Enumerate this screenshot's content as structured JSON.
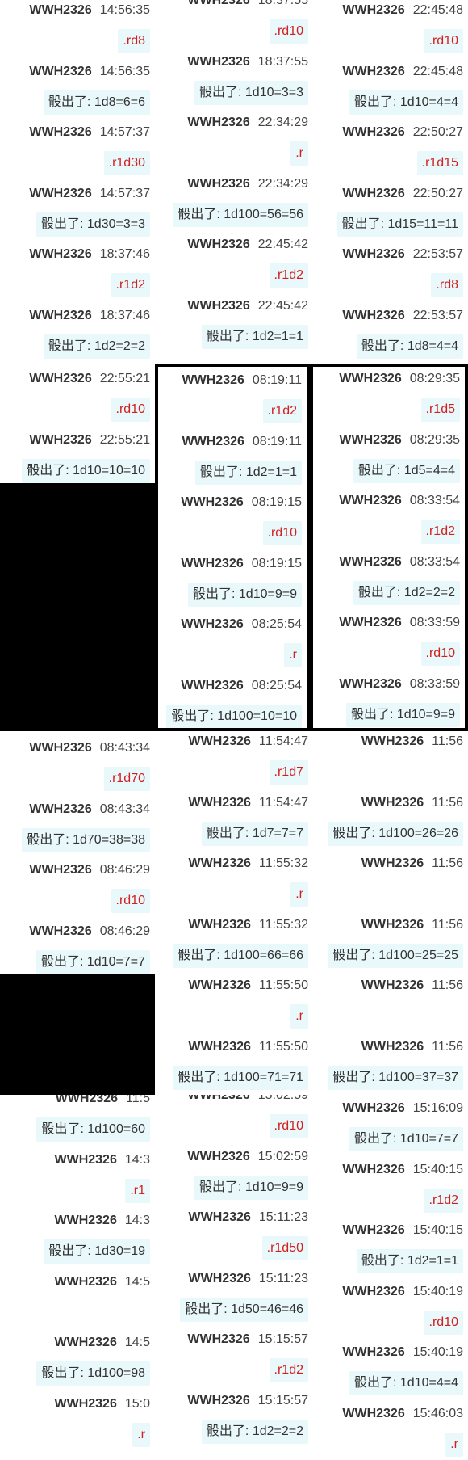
{
  "tiles": [
    {
      "messages": [
        {
          "name": "WWH2326",
          "time": "14:56:35",
          "type": "cmd",
          "text": ".rd8"
        },
        {
          "name": "WWH2326",
          "time": "14:56:35",
          "type": "res",
          "text": "骰出了: 1d8=6=6"
        },
        {
          "name": "WWH2326",
          "time": "14:57:37",
          "type": "cmd",
          "text": ".r1d30"
        },
        {
          "name": "WWH2326",
          "time": "14:57:37",
          "type": "res",
          "text": "骰出了: 1d30=3=3"
        },
        {
          "name": "WWH2326",
          "time": "18:37:46",
          "type": "cmd",
          "text": ".r1d2"
        },
        {
          "name": "WWH2326",
          "time": "18:37:46",
          "type": "res",
          "text": "骰出了: 1d2=2=2"
        }
      ]
    },
    {
      "messages": [
        {
          "name": "WWH2326",
          "time": "18:37:55",
          "type": "cmd",
          "text": ".rd10"
        },
        {
          "name": "WWH2326",
          "time": "18:37:55",
          "type": "res",
          "text": "骰出了: 1d10=3=3"
        },
        {
          "name": "WWH2326",
          "time": "22:34:29",
          "type": "cmd",
          "text": ".r"
        },
        {
          "name": "WWH2326",
          "time": "22:34:29",
          "type": "res",
          "text": "骰出了: 1d100=56=56"
        },
        {
          "name": "WWH2326",
          "time": "22:45:42",
          "type": "cmd",
          "text": ".r1d2"
        },
        {
          "name": "WWH2326",
          "time": "22:45:42",
          "type": "res",
          "text": "骰出了: 1d2=1=1"
        }
      ]
    },
    {
      "messages": [
        {
          "name": "WWH2326",
          "time": "22:45:48",
          "type": "cmd",
          "text": ".rd10"
        },
        {
          "name": "WWH2326",
          "time": "22:45:48",
          "type": "res",
          "text": "骰出了: 1d10=4=4"
        },
        {
          "name": "WWH2326",
          "time": "22:50:27",
          "type": "cmd",
          "text": ".r1d15"
        },
        {
          "name": "WWH2326",
          "time": "22:50:27",
          "type": "res",
          "text": "骰出了: 1d15=11=11"
        },
        {
          "name": "WWH2326",
          "time": "22:53:57",
          "type": "cmd",
          "text": ".rd8"
        },
        {
          "name": "WWH2326",
          "time": "22:53:57",
          "type": "res",
          "text": "骰出了: 1d8=4=4"
        }
      ]
    },
    {
      "messages": [
        {
          "name": "WWH2326",
          "time": "22:55:21",
          "type": "cmd",
          "text": ".rd10"
        },
        {
          "name": "WWH2326",
          "time": "22:55:21",
          "type": "res",
          "text": "骰出了: 1d10=10=10"
        }
      ]
    },
    {
      "messages": [
        {
          "name": "WWH2326",
          "time": "08:19:11",
          "type": "cmd",
          "text": ".r1d2"
        },
        {
          "name": "WWH2326",
          "time": "08:19:11",
          "type": "res",
          "text": "骰出了: 1d2=1=1"
        },
        {
          "name": "WWH2326",
          "time": "08:19:15",
          "type": "cmd",
          "text": ".rd10"
        },
        {
          "name": "WWH2326",
          "time": "08:19:15",
          "type": "res",
          "text": "骰出了: 1d10=9=9"
        },
        {
          "name": "WWH2326",
          "time": "08:25:54",
          "type": "cmd",
          "text": ".r"
        },
        {
          "name": "WWH2326",
          "time": "08:25:54",
          "type": "res",
          "text": "骰出了: 1d100=10=10"
        }
      ]
    },
    {
      "messages": [
        {
          "name": "WWH2326",
          "time": "08:29:35",
          "type": "cmd",
          "text": ".r1d5"
        },
        {
          "name": "WWH2326",
          "time": "08:29:35",
          "type": "res",
          "text": "骰出了: 1d5=4=4"
        },
        {
          "name": "WWH2326",
          "time": "08:33:54",
          "type": "cmd",
          "text": ".r1d2"
        },
        {
          "name": "WWH2326",
          "time": "08:33:54",
          "type": "res",
          "text": "骰出了: 1d2=2=2"
        },
        {
          "name": "WWH2326",
          "time": "08:33:59",
          "type": "cmd",
          "text": ".rd10"
        },
        {
          "name": "WWH2326",
          "time": "08:33:59",
          "type": "res",
          "text": "骰出了: 1d10=9=9"
        }
      ]
    },
    {
      "messages": [
        {
          "name": "WWH2326",
          "time": "08:43:34",
          "type": "cmd",
          "text": ".r1d70"
        },
        {
          "name": "WWH2326",
          "time": "08:43:34",
          "type": "res",
          "text": "骰出了: 1d70=38=38"
        },
        {
          "name": "WWH2326",
          "time": "08:46:29",
          "type": "cmd",
          "text": ".rd10"
        },
        {
          "name": "WWH2326",
          "time": "08:46:29",
          "type": "res",
          "text": "骰出了: 1d10=7=7"
        }
      ]
    },
    {
      "messages": [
        {
          "name": "WWH2326",
          "time": "11:54:47",
          "type": "cmd",
          "text": ".r1d7"
        },
        {
          "name": "WWH2326",
          "time": "11:54:47",
          "type": "res",
          "text": "骰出了: 1d7=7=7"
        },
        {
          "name": "WWH2326",
          "time": "11:55:32",
          "type": "cmd",
          "text": ".r"
        },
        {
          "name": "WWH2326",
          "time": "11:55:32",
          "type": "res",
          "text": "骰出了: 1d100=66=66"
        },
        {
          "name": "WWH2326",
          "time": "11:55:50",
          "type": "cmd",
          "text": ".r"
        },
        {
          "name": "WWH2326",
          "time": "11:55:50",
          "type": "res",
          "text": "骰出了: 1d100=71=71"
        }
      ]
    },
    {
      "messages": [
        {
          "name": "WWH2326",
          "time": "11:56",
          "type": "cmd",
          "text": ""
        },
        {
          "name": "WWH2326",
          "time": "11:56",
          "type": "res",
          "text": "骰出了: 1d100=26=26"
        },
        {
          "name": "WWH2326",
          "time": "11:56",
          "type": "cmd",
          "text": ""
        },
        {
          "name": "WWH2326",
          "time": "11:56",
          "type": "res",
          "text": "骰出了: 1d100=25=25"
        },
        {
          "name": "WWH2326",
          "time": "11:56",
          "type": "cmd",
          "text": ""
        },
        {
          "name": "WWH2326",
          "time": "11:56",
          "type": "res",
          "text": "骰出了: 1d100=37=37"
        }
      ]
    },
    {
      "messages": [
        {
          "name": "WWH2326",
          "time": "11:5",
          "type": "res",
          "text": "骰出了: 1d100=60"
        },
        {
          "name": "WWH2326",
          "time": "14:3",
          "type": "cmd",
          "text": ".r1"
        },
        {
          "name": "WWH2326",
          "time": "14:3",
          "type": "res",
          "text": "骰出了: 1d30=19"
        },
        {
          "name": "WWH2326",
          "time": "14:5",
          "type": "cmd",
          "text": ""
        },
        {
          "name": "WWH2326",
          "time": "14:5",
          "type": "res",
          "text": "骰出了: 1d100=98"
        },
        {
          "name": "WWH2326",
          "time": "15:0",
          "type": "cmd",
          "text": ".r"
        }
      ]
    },
    {
      "messages": [
        {
          "name": "WWH2326",
          "time": "15:02:59",
          "type": "cmd",
          "text": ".rd10"
        },
        {
          "name": "WWH2326",
          "time": "15:02:59",
          "type": "res",
          "text": "骰出了: 1d10=9=9"
        },
        {
          "name": "WWH2326",
          "time": "15:11:23",
          "type": "cmd",
          "text": ".r1d50"
        },
        {
          "name": "WWH2326",
          "time": "15:11:23",
          "type": "res",
          "text": "骰出了: 1d50=46=46"
        },
        {
          "name": "WWH2326",
          "time": "15:15:57",
          "type": "cmd",
          "text": ".r1d2"
        },
        {
          "name": "WWH2326",
          "time": "15:15:57",
          "type": "res",
          "text": "骰出了: 1d2=2=2"
        }
      ]
    },
    {
      "messages": [
        {
          "name": "WWH2326",
          "time": "15:16:09",
          "type": "res",
          "text": "骰出了: 1d10=7=7"
        },
        {
          "name": "WWH2326",
          "time": "15:40:15",
          "type": "cmd",
          "text": ".r1d2"
        },
        {
          "name": "WWH2326",
          "time": "15:40:15",
          "type": "res",
          "text": "骰出了: 1d2=1=1"
        },
        {
          "name": "WWH2326",
          "time": "15:40:19",
          "type": "cmd",
          "text": ".rd10"
        },
        {
          "name": "WWH2326",
          "time": "15:40:19",
          "type": "res",
          "text": "骰出了: 1d10=4=4"
        },
        {
          "name": "WWH2326",
          "time": "15:46:03",
          "type": "cmd",
          "text": ".r"
        }
      ]
    }
  ]
}
